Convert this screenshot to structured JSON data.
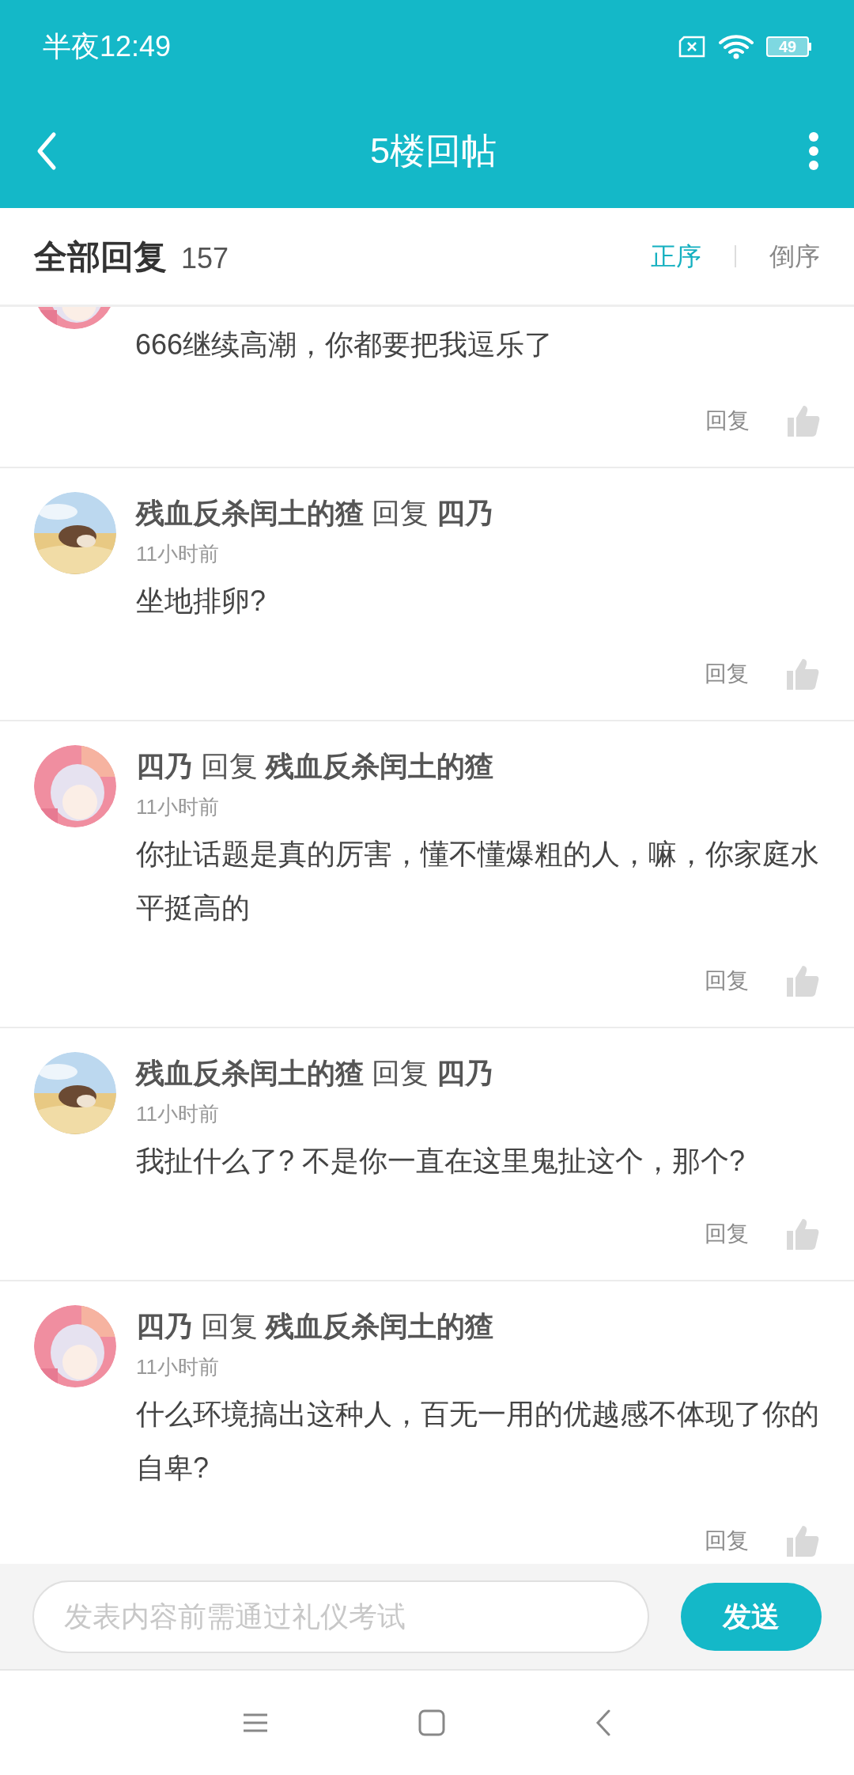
{
  "status_bar": {
    "time": "半夜12:49",
    "battery": "49"
  },
  "header": {
    "title": "5楼回帖"
  },
  "sort_bar": {
    "title": "全部回复",
    "count": "157",
    "options": [
      {
        "label": "正序",
        "selected": true
      },
      {
        "label": "倒序",
        "selected": false
      }
    ]
  },
  "comments": [
    {
      "kind": "clipped",
      "content": "666继续高潮，你都要把我逗乐了",
      "reply_label": "回复"
    },
    {
      "kind": "full",
      "author": "残血反杀闰土的猹",
      "reply_word": "回复",
      "target": "四乃",
      "time": "11小时前",
      "content": "坐地排卵?",
      "reply_label": "回复"
    },
    {
      "kind": "full",
      "author": "四乃",
      "reply_word": "回复",
      "target": "残血反杀闰土的猹",
      "time": "11小时前",
      "content": "你扯话题是真的厉害，懂不懂爆粗的人，嘛，你家庭水平挺高的",
      "reply_label": "回复"
    },
    {
      "kind": "full",
      "author": "残血反杀闰土的猹",
      "reply_word": "回复",
      "target": "四乃",
      "time": "11小时前",
      "content": "我扯什么了? 不是你一直在这里鬼扯这个，那个?",
      "reply_label": "回复"
    },
    {
      "kind": "full",
      "author": "四乃",
      "reply_word": "回复",
      "target": "残血反杀闰土的猹",
      "time": "11小时前",
      "content": "什么环境搞出这种人，百无一用的优越感不体现了你的自卑?",
      "reply_label": "回复"
    }
  ],
  "composer": {
    "placeholder": "发表内容前需通过礼仪考试",
    "send": "发送"
  }
}
